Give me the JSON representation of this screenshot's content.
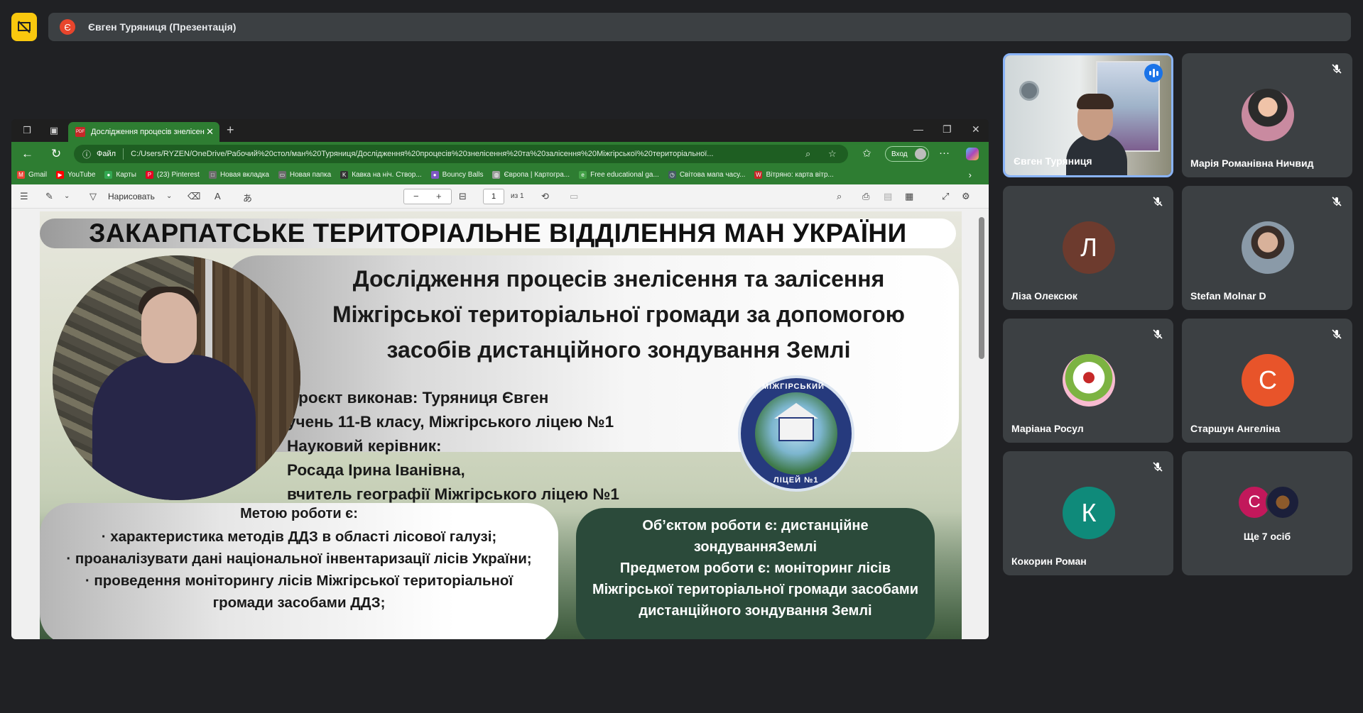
{
  "meeting": {
    "presenter_initial": "Є",
    "presenter_label": "Євген Туряниця (Презентація)"
  },
  "browser": {
    "tab_title": "Дослідження процесів знелісення",
    "file_label": "Файл",
    "url": "C:/Users/RYZEN/OneDrive/Рабочий%20стол/ман%20Туряниця/Дослідження%20процесів%20знелісення%20та%20залісення%20Міжгірської%20територіальної...",
    "signin_label": "Вход",
    "bookmarks": [
      {
        "label": "Gmail",
        "color": "#ea4335",
        "glyph": "M"
      },
      {
        "label": "YouTube",
        "color": "#ff0000",
        "glyph": "▶"
      },
      {
        "label": "Карты",
        "color": "#34a853",
        "glyph": "●"
      },
      {
        "label": "(23) Pinterest",
        "color": "#e60023",
        "glyph": "P"
      },
      {
        "label": "Новая вкладка",
        "color": "#6d6d6d",
        "glyph": "□"
      },
      {
        "label": "Новая папка",
        "color": "#6d6d6d",
        "glyph": "▭"
      },
      {
        "label": "Кавка на ніч. Створ...",
        "color": "#333333",
        "glyph": "K"
      },
      {
        "label": "Bouncy Balls",
        "color": "#7e57c2",
        "glyph": "●"
      },
      {
        "label": "Європа | Картогра...",
        "color": "#9e9e9e",
        "glyph": "◍"
      },
      {
        "label": "Free educational ga...",
        "color": "#43a047",
        "glyph": "e"
      },
      {
        "label": "Світова мапа часу...",
        "color": "#455a64",
        "glyph": "◷"
      },
      {
        "label": "Вітряно: карта вітр...",
        "color": "#c62828",
        "glyph": "W"
      }
    ]
  },
  "pdf_toolbar": {
    "draw_label": "Нарисовать",
    "page_value": "1",
    "page_of": "из 1"
  },
  "slide": {
    "banner": "ЗАКАРПАТСЬКЕ ТЕРИТОРІАЛЬНЕ ВІДДІЛЕННЯ МАН УКРАЇНИ",
    "title_lines": [
      "Дослідження процесів знелісення та залісення",
      "Міжгірської територіальної громади за допомогою",
      "засобів дистанційного зондування Землі"
    ],
    "info_lines": [
      "Проєкт виконав: Туряниця Євген",
      "учень 11-В класу, Міжгірського ліцею №1",
      "Науковий керівник:",
      "Росада Ірина Іванівна,",
      "вчитель географії Міжгірського ліцею №1"
    ],
    "emblem_top": "МІЖГІРСЬКИЙ",
    "emblem_bottom": "ЛІЦЕЙ №1",
    "aim_title": "Метою роботи є:",
    "aim_lines": [
      "· характеристика методів ДДЗ в області лісової галузі;",
      "· проаналізувати дані національної інвентаризації лісів України;",
      "· проведення моніторингу лісів Міжгірської територіальної",
      "громади засобами ДДЗ;"
    ],
    "object_lines": [
      "Об’єктом роботи є: дистанційне",
      "зондуванняЗемлі",
      "Предметом роботи є: моніторинг лісів",
      "Міжгірської територіальної громади засобами",
      "дистанційного зондування Землі"
    ]
  },
  "participants": [
    {
      "name": "Євген Туряниця",
      "type": "video",
      "speaking": true
    },
    {
      "name": "Марія Романівна Ничвид",
      "type": "photo",
      "muted": true
    },
    {
      "name": "Ліза Олексюк",
      "type": "letter",
      "initial": "Л",
      "color": "#6d3b2e",
      "muted": true
    },
    {
      "name": "Stefan Molnar D",
      "type": "photo",
      "muted": true
    },
    {
      "name": "Маріана Росул",
      "type": "photo",
      "muted": true
    },
    {
      "name": "Старшун Ангеліна",
      "type": "letter",
      "initial": "С",
      "color": "#e8542a",
      "muted": true
    },
    {
      "name": "Кокорин Роман",
      "type": "letter",
      "initial": "К",
      "color": "#0f8a7a",
      "muted": true
    },
    {
      "name": "Ще 7 осіб",
      "type": "more",
      "initial": "С",
      "color": "#c2185b"
    }
  ]
}
